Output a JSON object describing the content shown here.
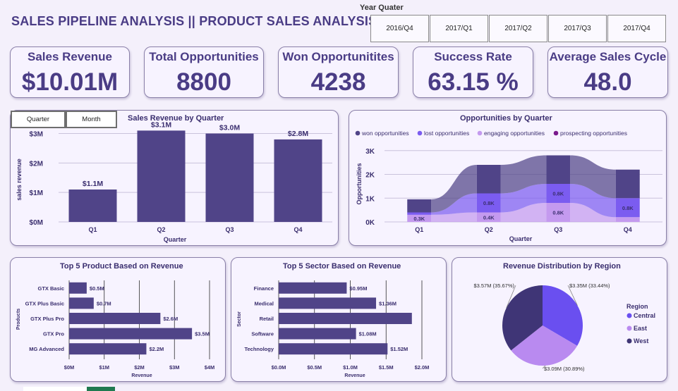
{
  "header": {
    "title": "SALES PIPELINE ANALYSIS || PRODUCT SALES ANALYSIS",
    "slicer_label": "Year Quater",
    "slicer_options": [
      "2016/Q4",
      "2017/Q1",
      "2017/Q2",
      "2017/Q3",
      "2017/Q4"
    ]
  },
  "kpis": [
    {
      "label": "Sales Revenue",
      "value": "$10.01M"
    },
    {
      "label": "Total Opportunities",
      "value": "8800"
    },
    {
      "label": "Won Opportunitites",
      "value": "4238"
    },
    {
      "label": "Success Rate",
      "value": "63.15 %"
    },
    {
      "label": "Average Sales Cycle",
      "value": "48.0"
    }
  ],
  "toggles": {
    "quarter": "Quarter",
    "month": "Month"
  },
  "colors": {
    "primary": "#504488",
    "won": "#504488",
    "lost": "#7b5cf0",
    "engaging": "#c49aef",
    "prospecting": "#7a1a8c",
    "west": "#3f3576",
    "central": "#6a4ff0",
    "east": "#b98af0"
  },
  "chart_data": [
    {
      "id": "revenue_by_quarter",
      "type": "bar",
      "title": "Sales Revenue by Quarter",
      "xlabel": "Quarter",
      "ylabel": "sales revenue",
      "categories": [
        "Q1",
        "Q2",
        "Q3",
        "Q4"
      ],
      "values": [
        1.1,
        3.1,
        3.0,
        2.8
      ],
      "data_labels": [
        "$1.1M",
        "$3.1M",
        "$3.0M",
        "$2.8M"
      ],
      "y_ticks": [
        "$0M",
        "$1M",
        "$2M",
        "$3M"
      ],
      "ylim": [
        0,
        3.3
      ]
    },
    {
      "id": "opportunities_by_quarter",
      "type": "bar",
      "stacked": true,
      "title": "Opportunities by Quarter",
      "xlabel": "Quarter",
      "ylabel": "Opportunities",
      "categories": [
        "Q1",
        "Q2",
        "Q3",
        "Q4"
      ],
      "y_ticks": [
        "0K",
        "1K",
        "2K",
        "3K"
      ],
      "ylim": [
        0,
        3.2
      ],
      "legend_position": "top",
      "series": [
        {
          "name": "prospecting opportunities",
          "values": [
            0.0,
            0.0,
            0.0,
            0.0
          ]
        },
        {
          "name": "engaging opportunities",
          "values": [
            0.3,
            0.4,
            0.8,
            0.2
          ]
        },
        {
          "name": "lost opportunities",
          "values": [
            0.1,
            0.8,
            0.8,
            0.8
          ]
        },
        {
          "name": "won opportunities",
          "values": [
            0.55,
            1.2,
            1.2,
            1.2
          ]
        }
      ],
      "data_labels": [
        {
          "category": "Q1",
          "text": "0.3K",
          "level": 0.15
        },
        {
          "category": "Q2",
          "text": "0.4K",
          "level": 0.2
        },
        {
          "category": "Q2",
          "text": "0.8K",
          "level": 0.8
        },
        {
          "category": "Q3",
          "text": "0.8K",
          "level": 0.4
        },
        {
          "category": "Q3",
          "text": "0.8K",
          "level": 1.2
        },
        {
          "category": "Q4",
          "text": "0.8K",
          "level": 0.6
        }
      ]
    },
    {
      "id": "top5_products",
      "type": "bar",
      "orientation": "horizontal",
      "title": "Top 5 Product Based on Revenue",
      "xlabel": "Revenue",
      "ylabel": "Products",
      "categories": [
        "GTX Basic",
        "GTX Plus Basic",
        "GTX Plus Pro",
        "GTX Pro",
        "MG Advanced"
      ],
      "values": [
        0.5,
        0.7,
        2.6,
        3.5,
        2.2
      ],
      "data_labels": [
        "$0.5M",
        "$0.7M",
        "$2.6M",
        "$3.5M",
        "$2.2M"
      ],
      "x_ticks": [
        "$0M",
        "$1M",
        "$2M",
        "$3M",
        "$4M"
      ],
      "x_tick_values": [
        0,
        1,
        2,
        3,
        4
      ],
      "xlim": [
        0,
        4
      ]
    },
    {
      "id": "top5_sectors",
      "type": "bar",
      "orientation": "horizontal",
      "title": "Top 5 Sector Based on Revenue",
      "xlabel": "Revenue",
      "ylabel": "Sector",
      "categories": [
        "Finance",
        "Medical",
        "Retail",
        "Software",
        "Technology"
      ],
      "values": [
        0.95,
        1.36,
        1.86,
        1.08,
        1.52
      ],
      "data_labels": [
        "$0.95M",
        "$1.36M",
        "",
        "$1.08M",
        "$1.52M"
      ],
      "x_ticks": [
        "$0.0M",
        "$0.5M",
        "$1.0M",
        "$1.5M",
        "$2.0M"
      ],
      "x_tick_values": [
        0,
        0.5,
        1.0,
        1.5,
        2.0
      ],
      "xlim": [
        0,
        2.0
      ]
    },
    {
      "id": "revenue_by_region",
      "type": "pie",
      "title": "Revenue Distribution by Region",
      "legend_title": "Region",
      "legend_position": "right",
      "slices": [
        {
          "name": "Central",
          "value": 3.35,
          "label": "$3.35M (33.44%)"
        },
        {
          "name": "East",
          "value": 3.09,
          "label": "$3.09M (30.89%)"
        },
        {
          "name": "West",
          "value": 3.57,
          "label": "$3.57M (35.67%)"
        }
      ]
    }
  ]
}
